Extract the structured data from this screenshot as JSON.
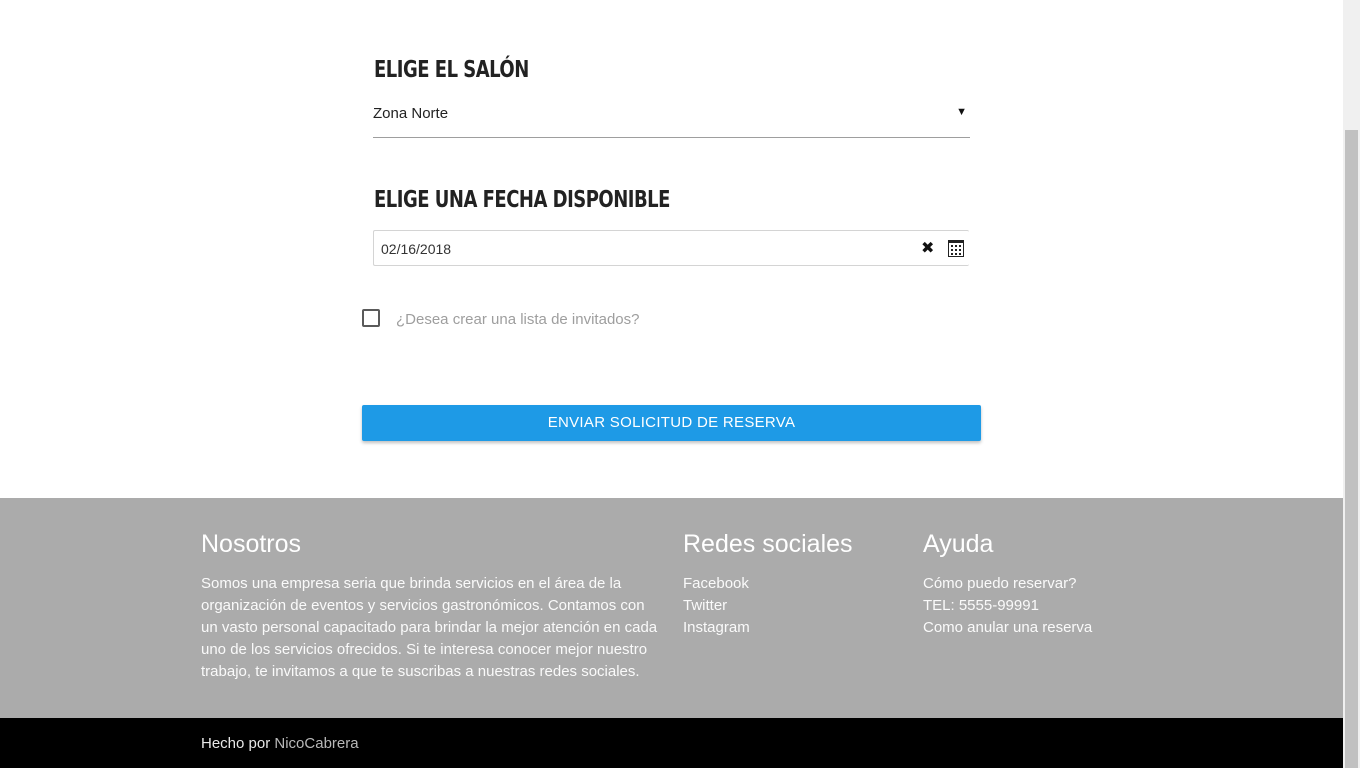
{
  "form": {
    "salon_heading": "ELIGE EL SALÓN",
    "salon_selected": "Zona Norte",
    "salon_caret": "▼",
    "date_heading": "ELIGE UNA FECHA DISPONIBLE",
    "date_value": "02/16/2018",
    "date_clear": "✖",
    "guest_list_label": "¿Desea crear una lista de invitados?",
    "submit_label": "ENVIAR SOLICITUD DE RESERVA"
  },
  "footer": {
    "about_title": "Nosotros",
    "about_text": "Somos una empresa seria que brinda servicios en el área de la organización de eventos y servicios gastronómicos. Contamos con un vasto personal capacitado para brindar la mejor atención en cada uno de los servicios ofrecidos. Si te interesa conocer mejor nuestro trabajo, te invitamos a que te suscribas a nuestras redes sociales.",
    "social_title": "Redes sociales",
    "social_links": [
      "Facebook",
      "Twitter",
      "Instagram"
    ],
    "help_title": "Ayuda",
    "help_links": [
      "Cómo puedo reservar?",
      "TEL: 5555-99991",
      "Como anular una reserva"
    ]
  },
  "bottom": {
    "made_by": "Hecho por",
    "author": "NicoCabrera"
  },
  "colors": {
    "button": "#1e9ae6",
    "footer_bg": "#ababab",
    "bottombar_bg": "#000000"
  },
  "icons": {
    "clear": "close-icon",
    "calendar": "calendar-icon",
    "caret": "caret-down-icon"
  }
}
